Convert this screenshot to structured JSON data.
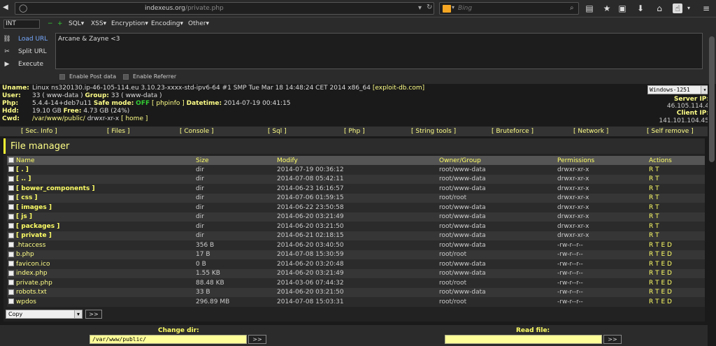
{
  "browser": {
    "url_host": "indexeus.org",
    "url_path": "/private.php",
    "search_placeholder": "Bing"
  },
  "hackbar": {
    "type_select": "INT",
    "menus": [
      "SQL▾",
      "XSS▾",
      "Encryption▾",
      "Encoding▾",
      "Other▾"
    ],
    "load_url": "Load URL",
    "split_url": "Split URL",
    "execute": "Execute",
    "textarea": "Arcane & Zayne <3",
    "enable_post": "Enable Post data",
    "enable_referrer": "Enable Referrer"
  },
  "info": {
    "uname_label": "Uname:",
    "uname": "Linux ns320130.ip-46-105-114.eu 3.10.23-xxxx-std-ipv6-64 #1 SMP Tue Mar 18 14:48:24 CET 2014 x86_64",
    "exploit": "[exploit-db.com]",
    "user_label": "User:",
    "user": "33 ( www-data )",
    "group_label": "Group:",
    "group": "33 ( www-data )",
    "php_label": "Php:",
    "php": "5.4.4-14+deb7u11",
    "safe_label": "Safe mode:",
    "safe": "OFF",
    "phpinfo": "[ phpinfo ]",
    "datetime_label": "Datetime:",
    "datetime": "2014-07-19 00:41:15",
    "hdd_label": "Hdd:",
    "hdd": "19.10 GB",
    "free_label": "Free:",
    "free": "4.73 GB (24%)",
    "cwd_label": "Cwd:",
    "cwd": "/var/www/public/",
    "cwd_perm": "drwxr-xr-x",
    "home": "[ home ]",
    "charset": "Windows-1251",
    "server_ip_label": "Server IP:",
    "server_ip": "46.105.114.4",
    "client_ip_label": "Client IP:",
    "client_ip": "141.101.104.45"
  },
  "menu": [
    "[ Sec. Info ]",
    "[ Files ]",
    "[ Console ]",
    "[ Sql ]",
    "[ Php ]",
    "[ String tools ]",
    "[ Bruteforce ]",
    "[ Network ]",
    "[ Self remove ]"
  ],
  "fm": {
    "title": "File manager",
    "headers": [
      "Name",
      "Size",
      "Modify",
      "Owner/Group",
      "Permissions",
      "Actions"
    ],
    "rows": [
      {
        "name": "[ . ]",
        "size": "dir",
        "mod": "2014-07-19 00:36:12",
        "own": "root/www-data",
        "perm": "drwxr-xr-x",
        "act": "R T",
        "dir": true
      },
      {
        "name": "[ .. ]",
        "size": "dir",
        "mod": "2014-07-08 05:42:11",
        "own": "root/www-data",
        "perm": "drwxr-xr-x",
        "act": "R T",
        "dir": true
      },
      {
        "name": "[ bower_components ]",
        "size": "dir",
        "mod": "2014-06-23 16:16:57",
        "own": "root/www-data",
        "perm": "drwxr-xr-x",
        "act": "R T",
        "dir": true
      },
      {
        "name": "[ css ]",
        "size": "dir",
        "mod": "2014-07-06 01:59:15",
        "own": "root/root",
        "perm": "drwxr-xr-x",
        "act": "R T",
        "dir": true
      },
      {
        "name": "[ images ]",
        "size": "dir",
        "mod": "2014-06-22 23:50:58",
        "own": "root/www-data",
        "perm": "drwxr-xr-x",
        "act": "R T",
        "dir": true
      },
      {
        "name": "[ js ]",
        "size": "dir",
        "mod": "2014-06-20 03:21:49",
        "own": "root/www-data",
        "perm": "drwxr-xr-x",
        "act": "R T",
        "dir": true
      },
      {
        "name": "[ packages ]",
        "size": "dir",
        "mod": "2014-06-20 03:21:50",
        "own": "root/www-data",
        "perm": "drwxr-xr-x",
        "act": "R T",
        "dir": true
      },
      {
        "name": "[ private ]",
        "size": "dir",
        "mod": "2014-06-21 02:18:15",
        "own": "root/www-data",
        "perm": "drwxr-xr-x",
        "act": "R T",
        "dir": true
      },
      {
        "name": ".htaccess",
        "size": "356 B",
        "mod": "2014-06-20 03:40:50",
        "own": "root/www-data",
        "perm": "-rw-r--r--",
        "act": "R T E D",
        "dir": false
      },
      {
        "name": "b.php",
        "size": "17 B",
        "mod": "2014-07-08 15:30:59",
        "own": "root/root",
        "perm": "-rw-r--r--",
        "act": "R T E D",
        "dir": false
      },
      {
        "name": "favicon.ico",
        "size": "0 B",
        "mod": "2014-06-20 03:20:48",
        "own": "root/www-data",
        "perm": "-rw-r--r--",
        "act": "R T E D",
        "dir": false
      },
      {
        "name": "index.php",
        "size": "1.55 KB",
        "mod": "2014-06-20 03:21:49",
        "own": "root/www-data",
        "perm": "-rw-r--r--",
        "act": "R T E D",
        "dir": false
      },
      {
        "name": "private.php",
        "size": "88.48 KB",
        "mod": "2014-03-06 07:44:32",
        "own": "root/root",
        "perm": "-rw-r--r--",
        "act": "R T E D",
        "dir": false
      },
      {
        "name": "robots.txt",
        "size": "33 B",
        "mod": "2014-06-20 03:21:50",
        "own": "root/www-data",
        "perm": "-rw-r--r--",
        "act": "R T E D",
        "dir": false
      },
      {
        "name": "wpdos",
        "size": "296.89 MB",
        "mod": "2014-07-08 15:03:31",
        "own": "root/root",
        "perm": "-rw-r--r--",
        "act": "R T E D",
        "dir": false
      }
    ],
    "copy": "Copy",
    "go": ">>"
  },
  "bottom": {
    "change_dir": "Change dir:",
    "cwd_value": "/var/www/public/",
    "read_file": "Read file:",
    "go": ">>"
  }
}
